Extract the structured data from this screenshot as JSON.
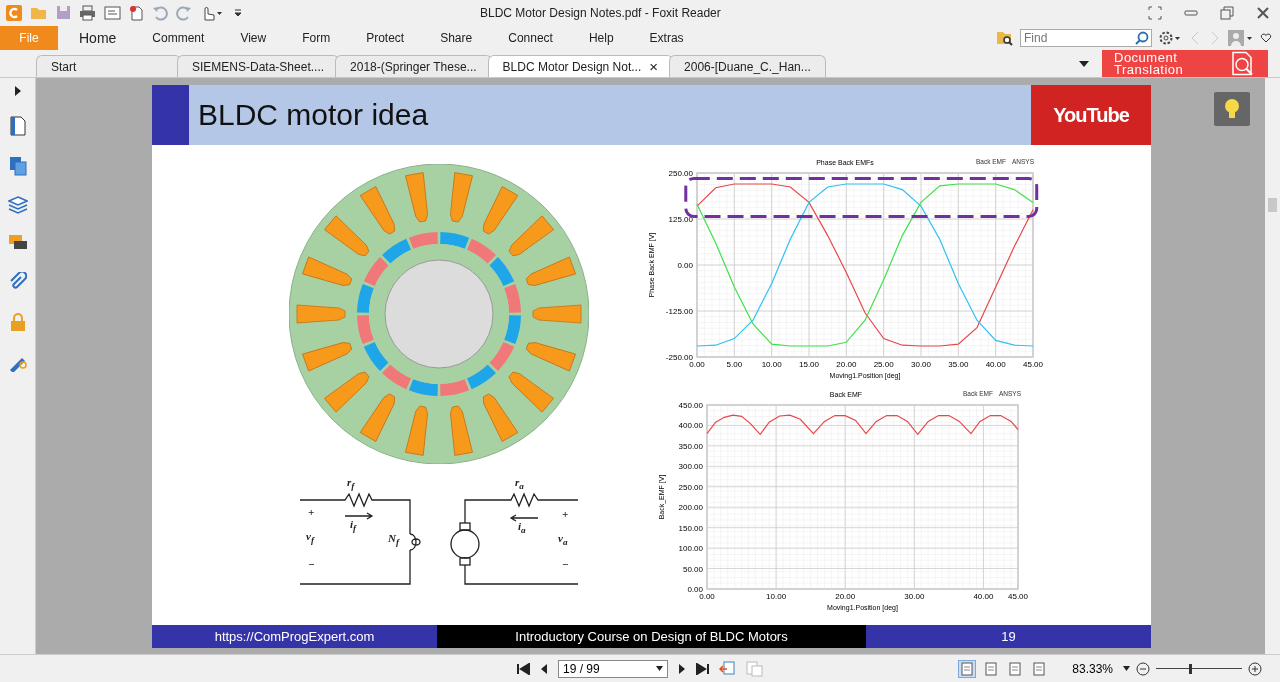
{
  "window": {
    "title": "BLDC Motor Design Notes.pdf - Foxit Reader"
  },
  "ribbon": {
    "file": "File",
    "tabs": [
      {
        "label": "Home",
        "selected": true
      },
      {
        "label": "Comment",
        "selected": false
      },
      {
        "label": "View",
        "selected": false
      },
      {
        "label": "Form",
        "selected": false
      },
      {
        "label": "Protect",
        "selected": false
      },
      {
        "label": "Share",
        "selected": false
      },
      {
        "label": "Connect",
        "selected": false
      },
      {
        "label": "Help",
        "selected": false
      },
      {
        "label": "Extras",
        "selected": false
      }
    ]
  },
  "search": {
    "placeholder": "Find"
  },
  "doc_tabs": [
    {
      "label": "Start",
      "selected": false
    },
    {
      "label": "SIEMENS-Data-Sheet....",
      "selected": false
    },
    {
      "label": "2018-(Springer These...",
      "selected": false
    },
    {
      "label": "BLDC Motor Design Not...",
      "selected": true,
      "close": "×"
    },
    {
      "label": "2006-[Duane_C._Han...",
      "selected": false
    }
  ],
  "translation_button": {
    "label": "Document Translation"
  },
  "slide": {
    "title": "BLDC motor idea",
    "logo": "YouTube",
    "circuit_labels": [
      "r$_{f}$",
      "r$_{a}$",
      "+",
      "i$_{f}$",
      "i$_{a}$",
      "+",
      "v$_{f}$",
      "N$_{f}$",
      "v$_{a}$",
      "−",
      "−"
    ],
    "charts": [
      {
        "legend": [
          "Back EMF",
          "ANSYS"
        ],
        "highlight_box": {
          "color": "#7030a0"
        },
        "chart_data": {
          "type": "line",
          "grid": true,
          "title": "Phase Back EMFs",
          "xlabel": "Moving1.Position [deg]",
          "ylabel": "Phase Back EMF [V]",
          "x": [
            0,
            2.5,
            5,
            7.5,
            10,
            12.5,
            15,
            17.5,
            20,
            22.5,
            25,
            27.5,
            30,
            32.5,
            35,
            37.5,
            40,
            42.5,
            45
          ],
          "series": [
            {
              "color": "#e8474a",
              "values": [
                160,
                210,
                220,
                220,
                220,
                212,
                170,
                80,
                -20,
                -130,
                -200,
                -218,
                -220,
                -220,
                -215,
                -170,
                -60,
                50,
                150
              ]
            },
            {
              "color": "#2fc0f0",
              "values": [
                -220,
                -218,
                -200,
                -150,
                -50,
                70,
                170,
                212,
                220,
                220,
                220,
                205,
                160,
                70,
                -50,
                -150,
                -205,
                -218,
                -220
              ]
            },
            {
              "color": "#3fe04a",
              "values": [
                165,
                60,
                -60,
                -160,
                -215,
                -220,
                -220,
                -220,
                -210,
                -150,
                -40,
                80,
                170,
                215,
                220,
                220,
                220,
                205,
                170
              ]
            }
          ],
          "xlim": [
            0,
            45
          ],
          "ylim": [
            -250,
            250
          ],
          "xticks": [
            {
              "value": 0,
              "label": "0.00"
            },
            {
              "value": 5,
              "label": "5.00"
            },
            {
              "value": 10,
              "label": "10.00"
            },
            {
              "value": 15,
              "label": "15.00"
            },
            {
              "value": 20,
              "label": "20.00"
            },
            {
              "value": 25,
              "label": "25.00"
            },
            {
              "value": 30,
              "label": "30.00"
            },
            {
              "value": 35,
              "label": "35.00"
            },
            {
              "value": 40,
              "label": "40.00"
            },
            {
              "value": 45,
              "label": "45.00"
            }
          ],
          "yticks": [
            {
              "value": -250,
              "label": "-250.00"
            },
            {
              "value": -125,
              "label": "-125.00"
            },
            {
              "value": 0,
              "label": "0.00"
            },
            {
              "value": 125,
              "label": "125.00"
            },
            {
              "value": 250,
              "label": "250.00"
            }
          ]
        }
      },
      {
        "legend": [
          "Back EMF",
          "ANSYS"
        ],
        "chart_data": {
          "type": "line",
          "grid": true,
          "title": "Back EMF",
          "xlabel": "Moving1.Position [deg]",
          "ylabel": "Back_EMF [V]",
          "x": [
            0,
            1.25,
            2.5,
            3.75,
            5,
            6.25,
            7.7,
            9,
            10.5,
            12,
            13.5,
            15.4,
            17,
            18.5,
            20,
            21.5,
            23,
            24.5,
            26,
            27.5,
            29,
            30.5,
            32,
            33.5,
            35,
            36.5,
            38.2,
            39.5,
            41,
            42.5,
            44,
            45
          ],
          "series": [
            {
              "color": "#e8474a",
              "values": [
                380,
                408,
                420,
                425,
                422,
                405,
                378,
                408,
                423,
                425,
                415,
                380,
                410,
                424,
                424,
                412,
                380,
                410,
                424,
                424,
                410,
                378,
                410,
                424,
                424,
                410,
                380,
                410,
                424,
                424,
                410,
                390
              ]
            }
          ],
          "xlim": [
            0,
            45
          ],
          "ylim": [
            0,
            450
          ],
          "xticks": [
            {
              "value": 0,
              "label": "0.00"
            },
            {
              "value": 10,
              "label": "10.00"
            },
            {
              "value": 20,
              "label": "20.00"
            },
            {
              "value": 30,
              "label": "30.00"
            },
            {
              "value": 40,
              "label": "40.00"
            },
            {
              "value": 45,
              "label": "45.00"
            }
          ],
          "yticks": [
            {
              "value": 0,
              "label": "0.00"
            },
            {
              "value": 50,
              "label": "50.00"
            },
            {
              "value": 100,
              "label": "100.00"
            },
            {
              "value": 150,
              "label": "150.00"
            },
            {
              "value": 200,
              "label": "200.00"
            },
            {
              "value": 250,
              "label": "250.00"
            },
            {
              "value": 300,
              "label": "300.00"
            },
            {
              "value": 350,
              "label": "350.00"
            },
            {
              "value": 400,
              "label": "400.00"
            },
            {
              "value": 450,
              "label": "450.00"
            }
          ]
        }
      }
    ],
    "footer": [
      "https://ComProgExpert.com",
      "Introductory Course on Design of BLDC Motors",
      "19"
    ]
  },
  "navigation": {
    "page": "19 / 99",
    "view_modes": [
      {
        "selected": true
      },
      {
        "selected": false
      },
      {
        "selected": false
      },
      {
        "selected": false
      }
    ],
    "zoom": "83.33%",
    "zoom_slider": {
      "level": 0.38
    }
  }
}
